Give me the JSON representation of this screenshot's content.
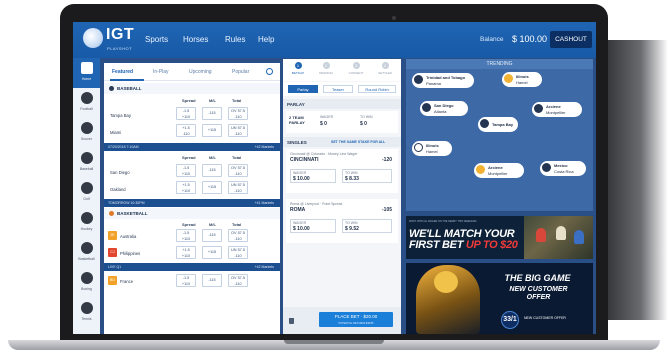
{
  "brand": {
    "name": "IGT",
    "sub": "PLAYSHOT"
  },
  "nav": {
    "items": [
      "Sports",
      "Horses",
      "Rules",
      "Help"
    ]
  },
  "account": {
    "balance_label": "Balance",
    "balance": "$ 100.00",
    "cashout": "CASHOUT"
  },
  "sidebar": {
    "items": [
      "Home",
      "Football",
      "Soccer",
      "Baseball",
      "Golf",
      "Hockey",
      "Basketball",
      "Boxing",
      "Tennis"
    ]
  },
  "events": {
    "tabs": [
      "Featured",
      "In-Play",
      "Upcoming",
      "Popular"
    ],
    "columns": [
      "Spread",
      "M/L",
      "Total"
    ],
    "baseball_label": "BASEBALL",
    "basketball_label": "BASKETBALL",
    "rows": [
      {
        "team": "Tampa Bay",
        "spread": [
          "-1.5",
          "+110"
        ],
        "ml": "-115",
        "total": [
          "OV 57.5",
          "-110"
        ]
      },
      {
        "team": "Miami",
        "spread": [
          "+1.5",
          "-110"
        ],
        "ml": "+115",
        "total": [
          "UN 57.5",
          "-110"
        ]
      },
      {
        "team": "San Diego",
        "spread": [
          "-1.5",
          "+110"
        ],
        "ml": "-115",
        "total": [
          "OV 57.5",
          "-110"
        ]
      },
      {
        "team": "Oakland",
        "spread": [
          "+1.5",
          "+110"
        ],
        "ml": "+115",
        "total": [
          "UN 57.5",
          "-110"
        ]
      },
      {
        "team": "Australia",
        "rank": "2E",
        "spread": [
          "-1.5",
          "+110"
        ],
        "ml": "-115",
        "total": [
          "OV 57.5",
          "-110"
        ]
      },
      {
        "team": "Philippines",
        "rank": "CJ",
        "spread": [
          "+1.5",
          "+110"
        ],
        "ml": "+115",
        "total": [
          "UN 57.5",
          "-110"
        ]
      },
      {
        "team": "France",
        "rank": "BO",
        "spread": [
          "-1.5",
          "+110"
        ],
        "ml": "-115",
        "total": [
          "OV 57.5",
          "-110"
        ]
      }
    ],
    "bars": [
      {
        "date": "07/20/2018 7:10AM",
        "markets": "+42 Markets"
      },
      {
        "date": "TOMORROW 10:30PM",
        "markets": "+41 Markets"
      },
      {
        "date": "LIVE Q1",
        "markets": "+42 Markets"
      }
    ]
  },
  "betslip": {
    "steps": [
      "BETSLIP",
      "PENDING",
      "CONSENT",
      "SETTLED"
    ],
    "tabs": [
      "Parlay",
      "Teaser",
      "Round Robin"
    ],
    "parlay_label": "PARLAY",
    "parlay_title": "2 TEAM PARLAY",
    "wager_label": "WAGER",
    "to_win_label": "TO WIN",
    "parlay_wager": "$ 0",
    "parlay_win": "$ 0",
    "singles_label": "SINGLES",
    "same_stake": "SET THE SAME STAKE FOR ALL",
    "bet1": {
      "match": "Cincinnati @ Colorado · Money Line Wager",
      "team": "CINCINNATI",
      "odds": "-120",
      "wager": "$ 10.00",
      "win": "$ 8.33"
    },
    "bet2": {
      "match": "Roma @ Liverpool · Point Spread",
      "team": "ROMA",
      "odds": "-105",
      "wager": "$ 10.00",
      "win": "$ 9.52"
    },
    "place_bet": "PLACE BET · $20.00",
    "place_sub": "POTENTIAL RETURNS $38.85"
  },
  "trending": {
    "title": "TRENDING",
    "bubbles": [
      {
        "a": "Trinidad and Tobago",
        "b": "Panama"
      },
      {
        "a": "Illinois",
        "b": "Hamel"
      },
      {
        "a": "San Diego",
        "b": "Atlanta"
      },
      {
        "a": "Arciene",
        "b": "Montpellier"
      },
      {
        "a": "Tampa Bay",
        "b": ""
      },
      {
        "a": "Illinois",
        "b": "Hamel"
      },
      {
        "a": "Arciene",
        "b": "Montpellier"
      },
      {
        "a": "Mexico",
        "b": "Costa Rica"
      }
    ]
  },
  "promo1": {
    "tiny": "FIRST VIRTUAL WAGER ON THE DERBY THIS WEEKEND",
    "line1": "WE'LL MATCH YOUR",
    "line2a": "FIRST BET ",
    "line2b": "UP TO $20"
  },
  "promo2": {
    "big": "THE BIG GAME",
    "new1": "NEW CUSTOMER",
    "new2": "OFFER",
    "badge": "33/1",
    "fine": "NEW CUSTOMER OFFER"
  },
  "colors": {
    "brand_blue": "#1f65b4",
    "dark_blue": "#0c2f63",
    "accent_red": "#f23a3a",
    "accent_yellow": "#f2b234"
  }
}
